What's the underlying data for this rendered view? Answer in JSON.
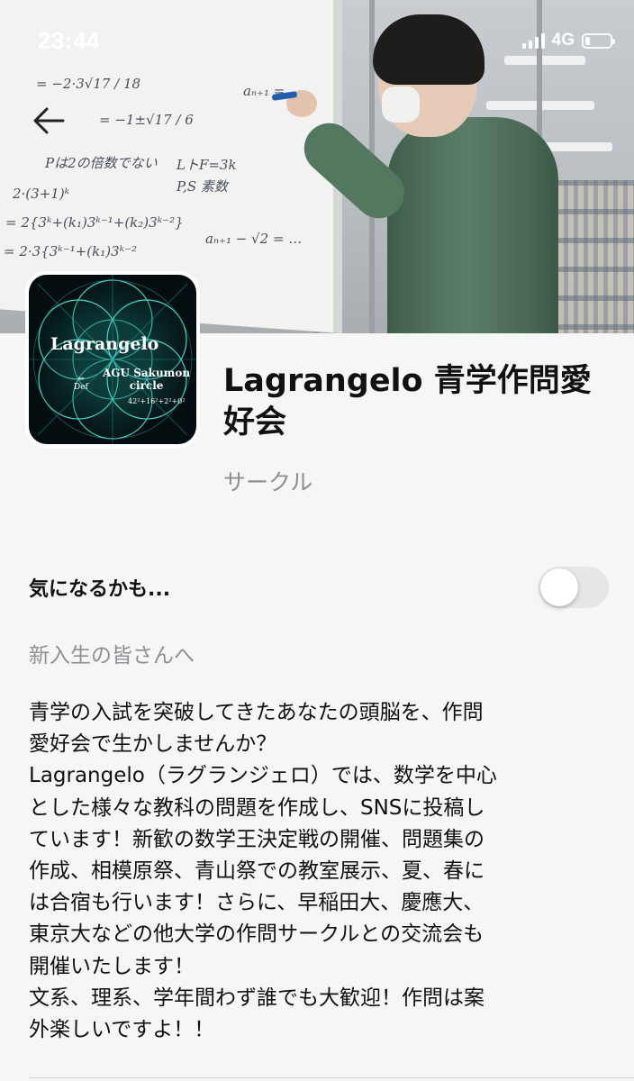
{
  "status_bar": {
    "time": "23:44",
    "network": "4G",
    "battery_level": 0.18
  },
  "header": {
    "back_icon": "arrow-left-icon"
  },
  "organization": {
    "logo": {
      "title": "Lagrangelo",
      "subtitle": "AGU Sakumon\ncircle",
      "def": "⇔\nDef",
      "formula": "42²+16²+2²+0²"
    },
    "name": "Lagrangelo 青学作問愛好会",
    "type": "サークル"
  },
  "interest": {
    "label": "気になるかも...",
    "enabled": false
  },
  "section": {
    "heading": "新入生の皆さんへ",
    "body": "青学の入試を突破してきたあなたの頭脳を、作問\n愛好会で生かしませんか？\nLagrangelo（ラグランジェロ）では、数学を中心\nとした様々な教科の問題を作成し、SNSに投稿し\nています！新歓の数学王決定戦の開催、問題集の\n作成、相模原祭、青山祭での教室展示、夏、春に\nは合宿も行います！さらに、早稲田大、慶應大、\n東京大などの他大学の作問サークルとの交流会も\n開催いたします！\n文系、理系、学年間わず誰でも大歓迎！作問は案\n外楽しいですよ！！"
  },
  "hero": {
    "board_lines": [
      "Pは2の倍数でない",
      "2·(3+1)ᵏ",
      "= 2{3ᵏ+(k₁)3ᵏ⁻¹+(k₂)3ᵏ⁻²}",
      "= 2·3{3ᵏ⁻¹+(k₁)3ᵏ⁻²",
      "= −2·3√17 / 18",
      "= −1±√17 / 6",
      "LトF=3k",
      "P,S 素数",
      "aₙ₊₁ − √2 = …",
      "aₙ₊₁ = …"
    ]
  }
}
